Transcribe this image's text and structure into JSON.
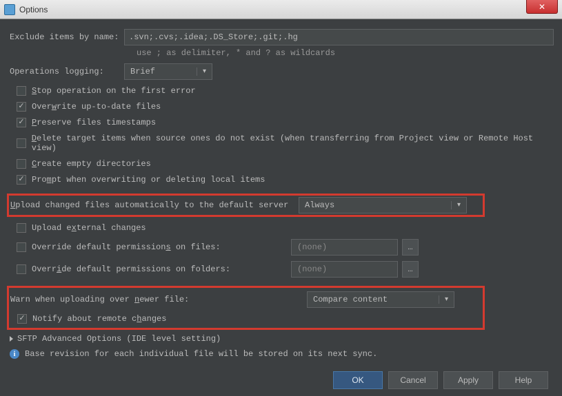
{
  "window": {
    "title": "Options"
  },
  "exclude": {
    "label": "Exclude items by name:",
    "value": ".svn;.cvs;.idea;.DS_Store;.git;.hg",
    "hint": "use ; as delimiter, * and ? as wildcards"
  },
  "logging": {
    "label": "Operations logging:",
    "value": "Brief"
  },
  "checks": {
    "stop": {
      "label_pre": "",
      "u": "S",
      "label_post": "top operation on the first error",
      "checked": false
    },
    "overwrite": {
      "label_pre": "Over",
      "u": "w",
      "label_post": "rite up-to-date files",
      "checked": true
    },
    "preserve": {
      "label_pre": "",
      "u": "P",
      "label_post": "reserve files timestamps",
      "checked": true
    },
    "delete": {
      "label_pre": "",
      "u": "D",
      "label_post": "elete target items when source ones do not exist (when transferring from Project view or Remote Host view)",
      "checked": false
    },
    "create": {
      "label_pre": "",
      "u": "C",
      "label_post": "reate empty directories",
      "checked": false
    },
    "prompt": {
      "label_pre": "Pro",
      "u": "m",
      "label_post": "pt when overwriting or deleting local items",
      "checked": true
    },
    "upload_ext": {
      "label_pre": "Upload e",
      "u": "x",
      "label_post": "ternal changes",
      "checked": false
    },
    "notify": {
      "label_pre": "Notify about remote c",
      "u": "h",
      "label_post": "anges",
      "checked": true
    }
  },
  "auto_upload": {
    "label_pre": "",
    "u": "U",
    "label_post": "pload changed files automatically to the default server",
    "value": "Always"
  },
  "perm_files": {
    "label_pre": "Override default permission",
    "u": "s",
    "label_post": " on files:",
    "value": "(none)"
  },
  "perm_folders": {
    "label_pre": "Overr",
    "u": "i",
    "label_post": "de default permissions on folders:",
    "value": "(none)"
  },
  "warn": {
    "label_pre": "Warn when uploading over ",
    "u": "n",
    "label_post": "ewer file:",
    "value": "Compare content"
  },
  "expander": {
    "label": "SFTP Advanced Options (IDE level setting)"
  },
  "info": {
    "text": "Base revision for each individual file will be stored on its next sync."
  },
  "buttons": {
    "ok": "OK",
    "cancel": "Cancel",
    "apply": "Apply",
    "help": "Help"
  }
}
